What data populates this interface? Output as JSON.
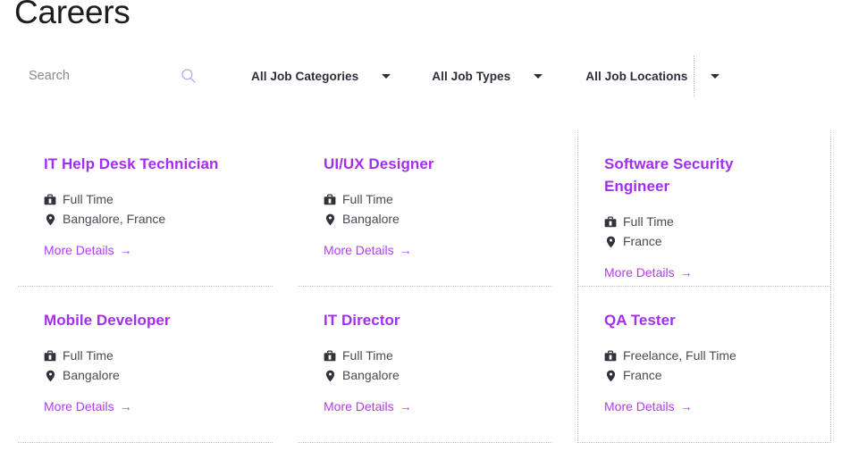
{
  "page": {
    "title": "Careers"
  },
  "filters": {
    "search": {
      "placeholder": "Search",
      "value": "",
      "icon": "search-icon"
    },
    "dropdowns": [
      {
        "label": "All Job Categories",
        "icon": "chevron-down-icon"
      },
      {
        "label": "All Job Types",
        "icon": "chevron-down-icon"
      },
      {
        "label": "All Job Locations",
        "icon": "chevron-down-icon"
      }
    ]
  },
  "labels": {
    "more_details": "More Details",
    "arrow": "→",
    "job_type_icon": "briefcase-icon",
    "location_icon": "map-pin-icon"
  },
  "colors": {
    "accent_purple": "#a32ef0",
    "link_purple": "#b03cf0",
    "title_dark": "#1c1c22",
    "meta_gray": "#4a4a54",
    "border_dotted": "#c3c3e4"
  },
  "jobs": [
    {
      "title": "IT Help Desk Technician",
      "job_type": "Full Time",
      "location": "Bangalore, France"
    },
    {
      "title": "UI/UX Designer",
      "job_type": "Full Time",
      "location": "Bangalore"
    },
    {
      "title": "Software Security Engineer",
      "job_type": "Full Time",
      "location": "France"
    },
    {
      "title": "Mobile Developer",
      "job_type": "Full Time",
      "location": "Bangalore"
    },
    {
      "title": "IT Director",
      "job_type": "Full Time",
      "location": "Bangalore"
    },
    {
      "title": "QA Tester",
      "job_type": "Freelance, Full Time",
      "location": "France"
    }
  ]
}
